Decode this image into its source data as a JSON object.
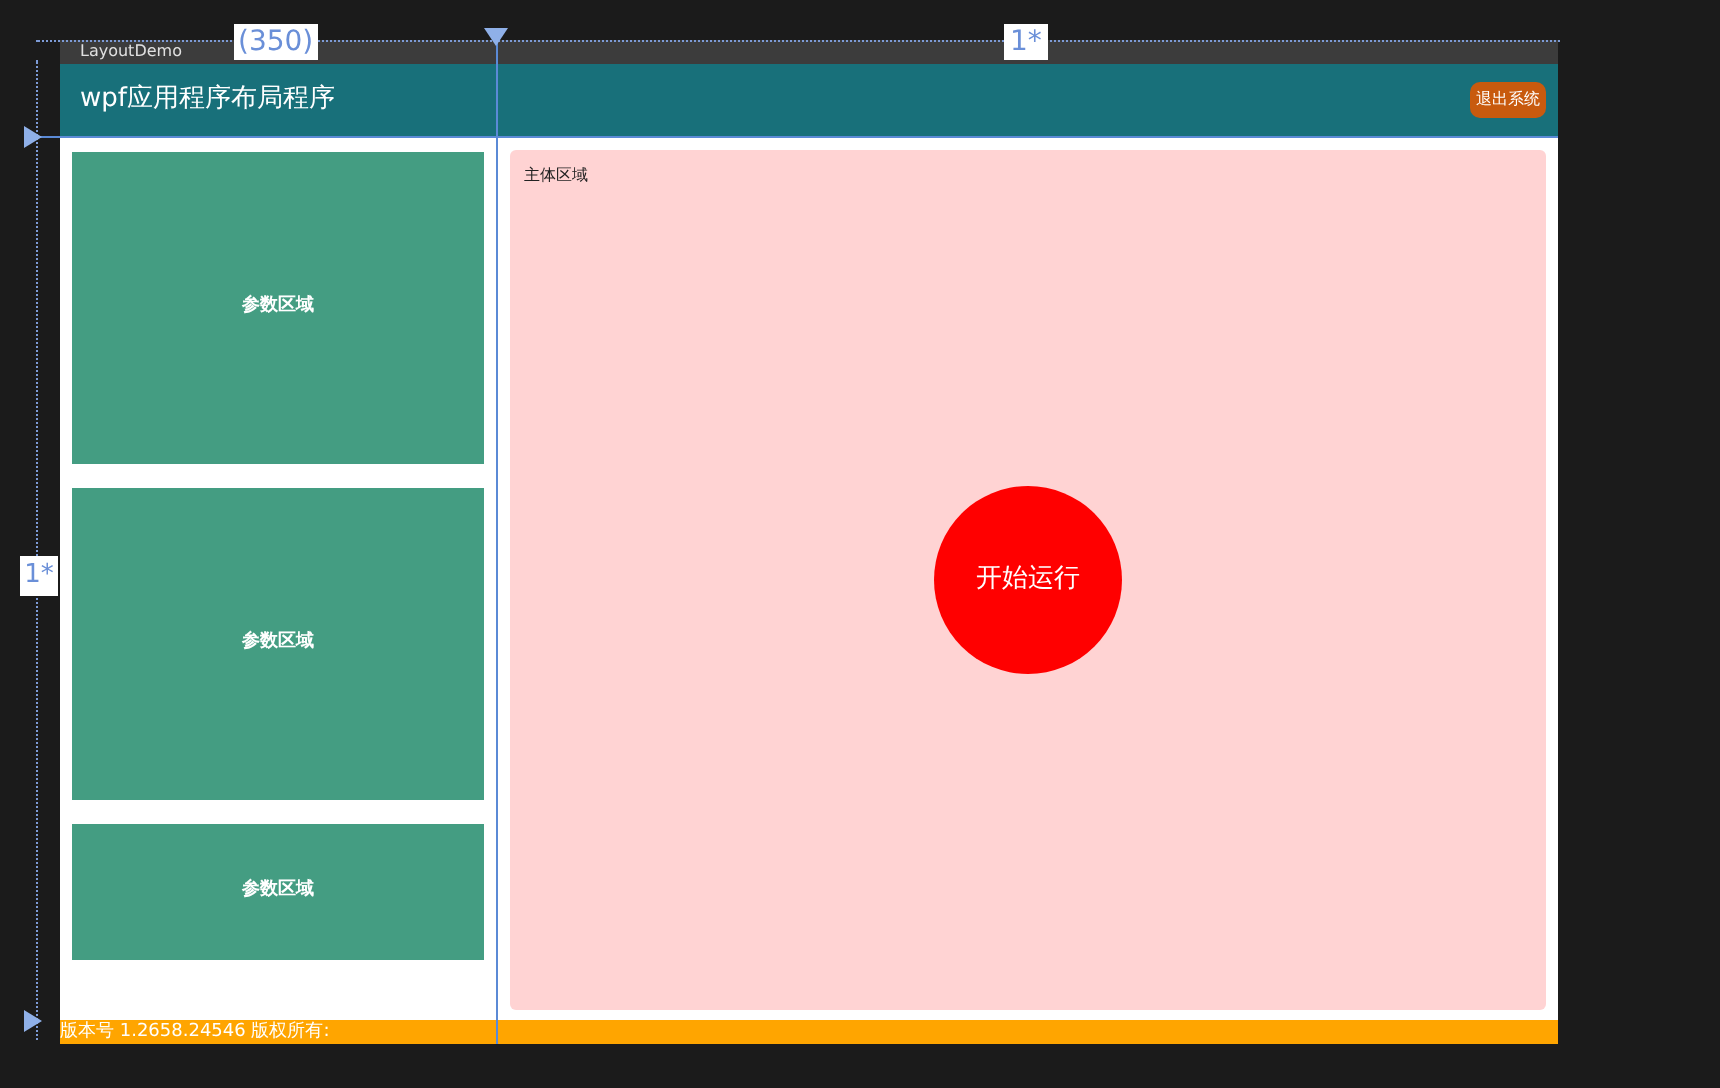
{
  "designer": {
    "column_labels": [
      "(350)",
      "1*"
    ],
    "row_labels": [
      "1*"
    ]
  },
  "window": {
    "title": "LayoutDemo",
    "header": {
      "title": "wpf应用程序布局程序",
      "button": "退出系统"
    },
    "param_panels": [
      "参数区域",
      "参数区域",
      "参数区域"
    ],
    "main": {
      "label": "主体区域",
      "start_button": "开始运行"
    },
    "status_bar": "版本号 1.2658.24546 版权所有:"
  }
}
